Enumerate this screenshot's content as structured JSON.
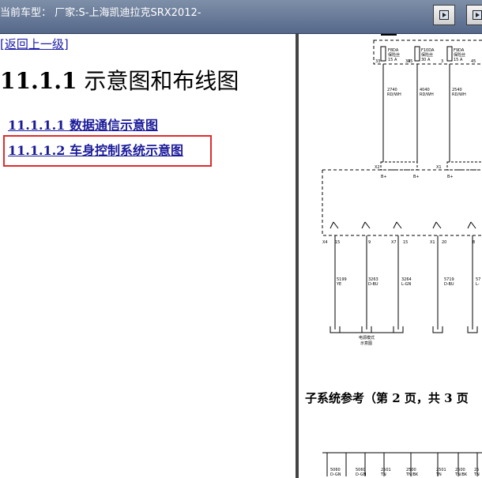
{
  "window": {
    "title": "当前车型：  厂家:S-上海凯迪拉克SRX2012-",
    "nav_icon": "navigate-forward-icon"
  },
  "left": {
    "back_link": "[返回上一级]",
    "heading_number": "11.1.1",
    "heading_text": " 示意图和布线图",
    "links": [
      "11.1.1.1 数据通信示意图",
      "11.1.1.2 车身控制系统示意图"
    ]
  },
  "diagram": {
    "fuses": [
      {
        "name": "F8DA",
        "desc": "保险丝",
        "rating": "15 A",
        "pin_in": "33",
        "pin_out": "34"
      },
      {
        "name": "F10DA",
        "desc": "保险丝",
        "rating": "30 A",
        "pin_in": "35",
        "pin_out": ""
      },
      {
        "name": "F9DA",
        "desc": "保险丝",
        "rating": "15 A",
        "pin_in": "3",
        "pin_out": "45"
      }
    ],
    "top_wires": [
      {
        "circuit": "2740",
        "color": "RD/WH"
      },
      {
        "circuit": "4040",
        "color": "RD/WH"
      },
      {
        "circuit": "2540",
        "color": "RD/WH"
      }
    ],
    "connector_x2": "X2",
    "connector_x1": "X1",
    "bplus": "B+",
    "switch_connectors": [
      {
        "conn": "X4",
        "pin": "15"
      },
      {
        "conn": "",
        "pin": "9"
      },
      {
        "conn": "X7",
        "pin": "15"
      },
      {
        "conn": "X1",
        "pin": "20"
      },
      {
        "conn": "",
        "pin": "8"
      }
    ],
    "bottom_wires": [
      {
        "circuit": "5199",
        "color": "YE"
      },
      {
        "circuit": "3263",
        "color": "D-BU"
      },
      {
        "circuit": "3264",
        "color": "L-GN"
      },
      {
        "circuit": "5719",
        "color": "D-BU"
      },
      {
        "circuit": "57",
        "color": "L-"
      }
    ],
    "mode_label_1": "电源模式",
    "mode_label_2": "示意图",
    "subsystem_ref": "子系统参考（第 2 页，共 3 页",
    "bottom_row": [
      {
        "circuit": "5060",
        "color": "D-GN"
      },
      {
        "circuit": "5060",
        "color": "D-GN"
      },
      {
        "circuit": "2501",
        "color": "TN"
      },
      {
        "circuit": "2500",
        "color": "TN/BK"
      },
      {
        "circuit": "2501",
        "color": "TN"
      },
      {
        "circuit": "2500",
        "color": "TN/BK"
      },
      {
        "circuit": "25",
        "color": "TN"
      }
    ]
  }
}
